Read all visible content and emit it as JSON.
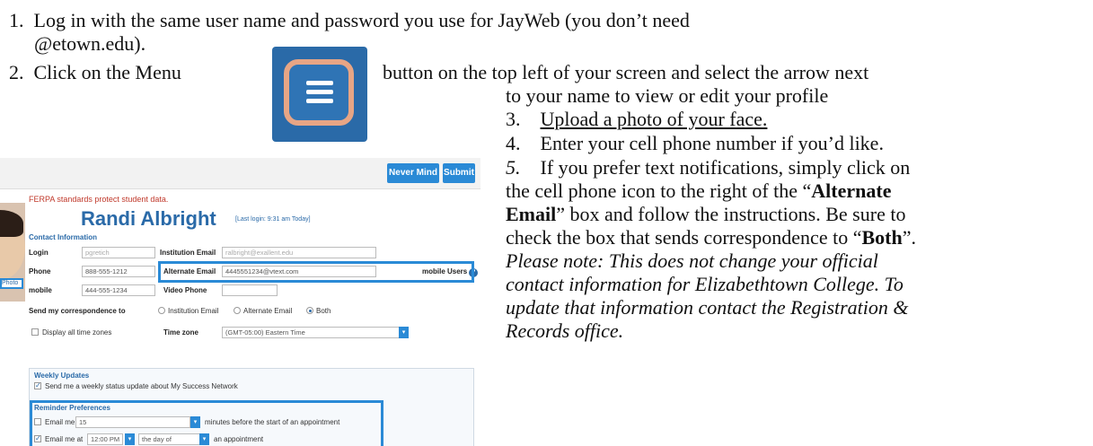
{
  "steps": [
    {
      "num": "1.",
      "line1": "Log in with the same user name and password you use for JayWeb (you don’t need",
      "line2": "@etown.edu)."
    },
    {
      "num": "2.",
      "pre": "Click on the Menu",
      "post": "button on the top left of your screen and select the arrow next",
      "line2": "to your name to view or edit your profile"
    },
    {
      "num": "3.",
      "text": "Upload a photo of your face."
    },
    {
      "num": "4.",
      "text": "Enter your cell phone number if you’d like."
    },
    {
      "num": "5.",
      "a": "If you prefer text notifications, simply click on",
      "b1": "the cell phone icon to the right of the “",
      "b2": "Alternate",
      "c1": "Email",
      "c2": "” box and follow the instructions.  Be sure to",
      "d1": "check the box that sends correspondence to “",
      "d2": "Both",
      "d3": "”."
    },
    {
      "note1": "Please note: This does not change your official",
      "note2": "contact information for Elizabethtown College.  To",
      "note3": "update that information contact the Registration &",
      "note4": "Records office."
    }
  ],
  "profile": {
    "btn_never": "Never Mind",
    "btn_submit": "Submit",
    "ferpa": "FERPA standards protect student data.",
    "name": "Randi Albright",
    "last_login": "[Last login: 9:31 am Today]",
    "photo_link": "Photo",
    "contact_header": "Contact Information",
    "login_label": "Login",
    "login_value": "pgretich",
    "inst_email_label": "Institution Email",
    "inst_email_value": "ralbright@exallent.edu",
    "phone_label": "Phone",
    "phone_value": "888-555-1212",
    "alt_email_label": "Alternate Email",
    "alt_email_value": "4445551234@vtext.com",
    "mobile_users": "mobile Users",
    "mobile_label": "mobile",
    "mobile_value": "444-555-1234",
    "video_label": "Video Phone",
    "corr_label": "Send my correspondence to",
    "opt_inst": "Institution Email",
    "opt_alt": "Alternate Email",
    "opt_both": "Both",
    "tz_all": "Display all time zones",
    "tz_label": "Time zone",
    "tz_value": "(GMT-05:00) Eastern Time",
    "weekly_header": "Weekly Updates",
    "weekly_text": "Send me a weekly status update about My Success Network",
    "reminder_header": "Reminder Preferences",
    "email_me": "Email me",
    "email_minutes": "15",
    "minutes_text": "minutes before the start of an appointment",
    "email_me_at": "Email me at",
    "time_value": "12:00 PM",
    "day_value": "the day of",
    "appt_text": "an appointment"
  }
}
